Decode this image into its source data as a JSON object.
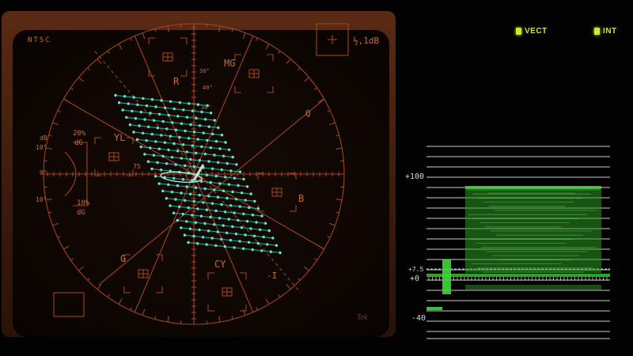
{
  "vectorscope": {
    "standard": "NTSC",
    "gain_label": "½,1dB",
    "color_targets": [
      "R",
      "MG",
      "B",
      "CY",
      "G",
      "YL"
    ],
    "axis_labels": {
      "q": "Q",
      "i": "-I"
    },
    "phase_marks": [
      "30°",
      "40°",
      "30°"
    ],
    "differential_gain": {
      "upper_db": "dB",
      "upper_deg": "10°",
      "upper_pct": "20%",
      "upper_dg": "dG",
      "zero_deg": "0°",
      "lower_deg": "10°",
      "lower_pct": "10%",
      "lower_dg": "dG",
      "mark_75": "75"
    },
    "bezel_text": "Tek",
    "colors": {
      "graticule": "#b04a22",
      "trace": "#3af5d8",
      "bezel": "#4a2210"
    }
  },
  "mode_indicators": [
    {
      "label": "VECT",
      "active": true
    },
    {
      "label": "INT",
      "active": true
    }
  ],
  "waveform": {
    "labels": {
      "top": "+100",
      "setup": "+7.5",
      "zero": "+0",
      "bottom": "-40"
    },
    "colors": {
      "graticule": "#ececec",
      "trace": "#3fd83a"
    }
  }
}
